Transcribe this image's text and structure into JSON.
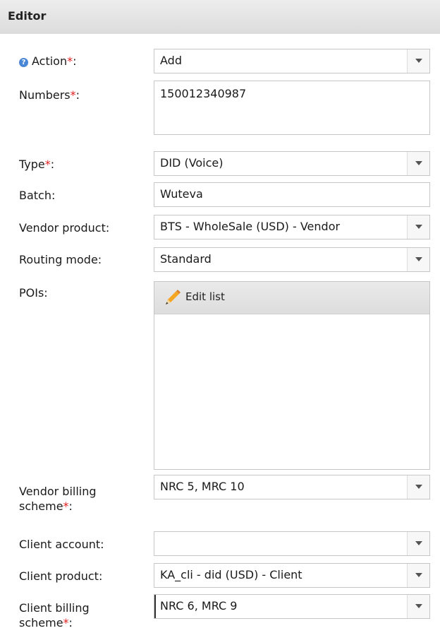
{
  "header": {
    "title": "Editor"
  },
  "fields": {
    "action": {
      "label": "Action",
      "value": "Add"
    },
    "numbers": {
      "label": "Numbers",
      "value": "150012340987"
    },
    "type": {
      "label": "Type",
      "value": "DID (Voice)"
    },
    "batch": {
      "label": "Batch:",
      "value": "Wuteva"
    },
    "vendor_product": {
      "label": "Vendor product:",
      "value": "BTS - WholeSale (USD) - Vendor"
    },
    "routing_mode": {
      "label": "Routing mode:",
      "value": "Standard"
    },
    "pois": {
      "label": "POIs:",
      "edit_label": "Edit list"
    },
    "vendor_billing_scheme": {
      "label_line1": "Vendor billing",
      "label_line2": "scheme",
      "value": "NRC 5, MRC 10"
    },
    "client_account": {
      "label": "Client account:",
      "value": ""
    },
    "client_product": {
      "label": "Client product:",
      "value": "KA_cli - did (USD) - Client"
    },
    "client_billing_scheme": {
      "label_line1": "Client billing",
      "label_line2": "scheme",
      "value": "NRC 6, MRC 9"
    }
  },
  "required_marker": "*",
  "colon": ":",
  "icons": {
    "help": "help-icon",
    "pencil": "pencil-icon",
    "dropdown": "chevron-down-icon"
  },
  "colors": {
    "required": "#e02020",
    "help_icon": "#4a86d6",
    "pencil": "#f5a623"
  }
}
